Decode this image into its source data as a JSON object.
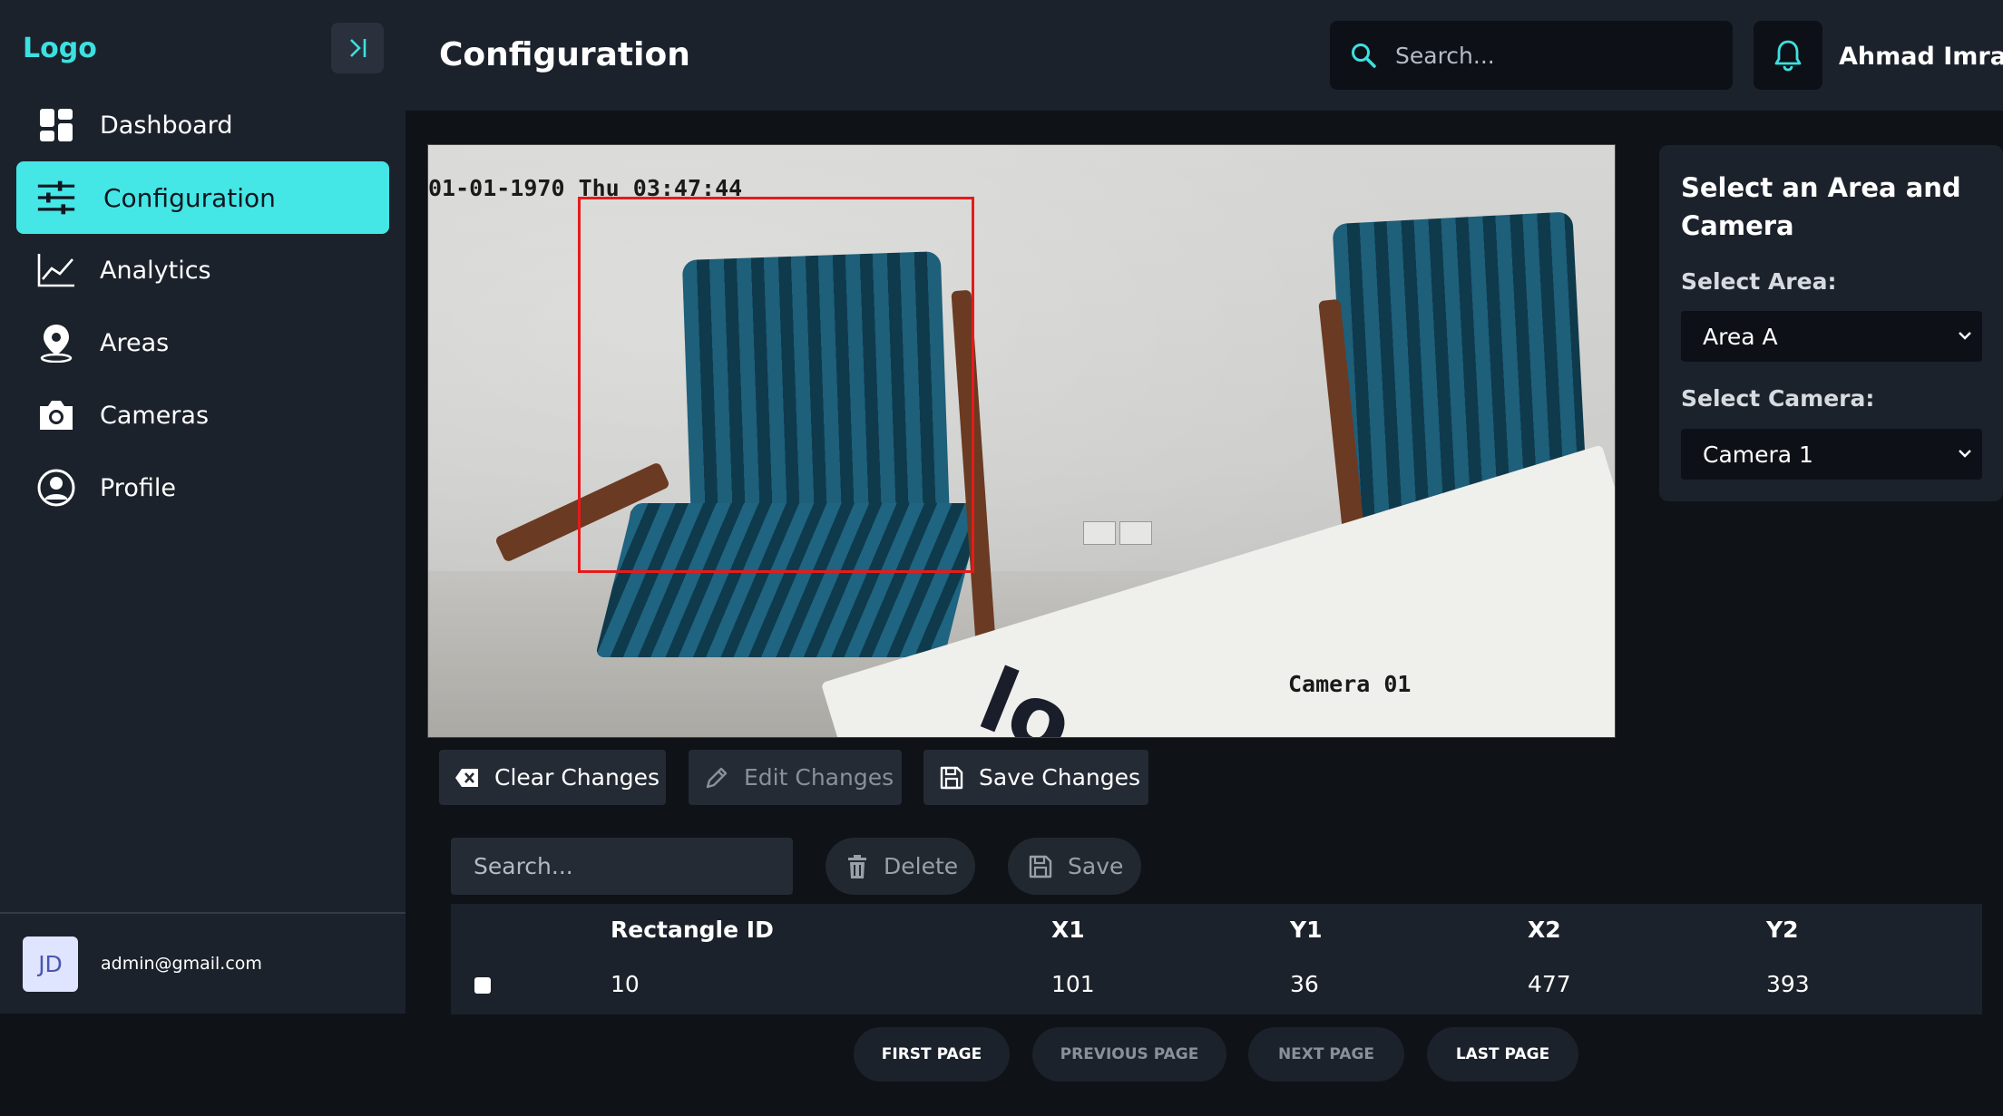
{
  "sidebar": {
    "logo": "Logo",
    "items": [
      {
        "label": "Dashboard",
        "icon": "dashboard-icon"
      },
      {
        "label": "Configuration",
        "icon": "sliders-icon",
        "active": true
      },
      {
        "label": "Analytics",
        "icon": "chart-line-icon"
      },
      {
        "label": "Areas",
        "icon": "map-pin-icon"
      },
      {
        "label": "Cameras",
        "icon": "camera-icon"
      },
      {
        "label": "Profile",
        "icon": "user-circle-icon"
      }
    ],
    "footer": {
      "avatar_initials": "JD",
      "email": "admin@gmail.com"
    }
  },
  "header": {
    "title": "Configuration",
    "search_placeholder": "Search...",
    "user_name": "Ahmad Imran"
  },
  "camera_view": {
    "timestamp": "01-01-1970 Thu 03:47:44",
    "camera_label": "Camera 01",
    "paper_text": "lo",
    "rectangle_color": "#e51b1b"
  },
  "select_panel": {
    "title": "Select an Area and Camera",
    "area_label": "Select Area:",
    "area_value": "Area A",
    "camera_label": "Select Camera:",
    "camera_value": "Camera 1"
  },
  "actions": {
    "clear": "Clear Changes",
    "edit": "Edit Changes",
    "save": "Save Changes"
  },
  "table": {
    "search_placeholder": "Search...",
    "delete_label": "Delete",
    "save_label": "Save",
    "headers": [
      "Rectangle ID",
      "X1",
      "Y1",
      "X2",
      "Y2"
    ],
    "rows": [
      {
        "id": "10",
        "x1": "101",
        "y1": "36",
        "x2": "477",
        "y2": "393"
      }
    ]
  },
  "pagination": {
    "first": "FIRST PAGE",
    "previous": "PREVIOUS PAGE",
    "next": "NEXT PAGE",
    "last": "LAST PAGE"
  },
  "colors": {
    "accent": "#45e6e6",
    "sidebar_bg": "#1c222b",
    "page_bg": "#0f1217"
  }
}
